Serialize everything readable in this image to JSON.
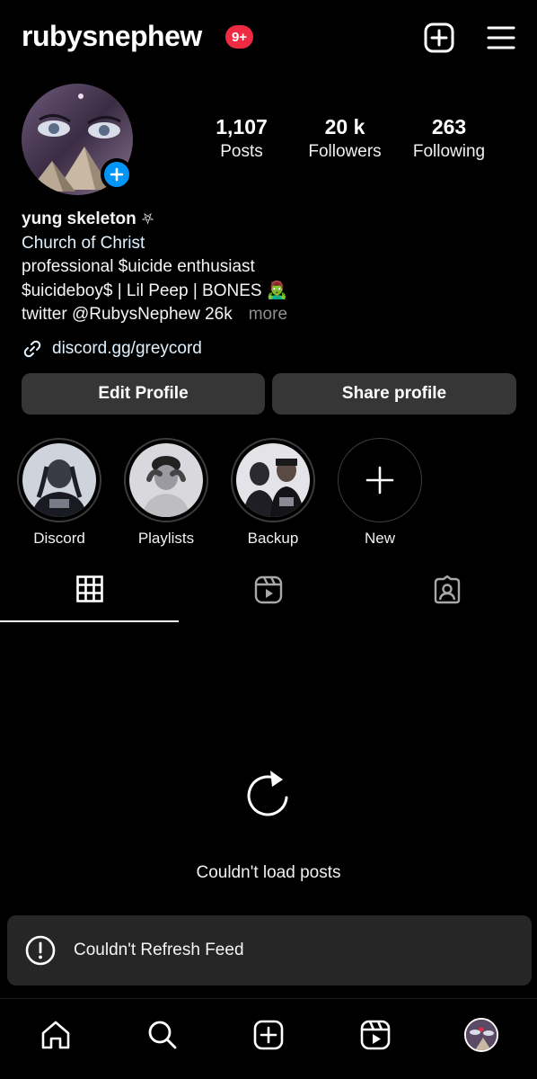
{
  "header": {
    "username": "rubysnephew",
    "notification_badge": "9+",
    "icons": [
      "add-post-icon",
      "menu-icon"
    ]
  },
  "profile": {
    "stats": {
      "posts_value": "1,107",
      "posts_label": "Posts",
      "followers_value": "20 k",
      "followers_label": "Followers",
      "following_value": "263",
      "following_label": "Following"
    },
    "display_name": "yung skeleton",
    "display_name_symbol": "⛧",
    "category": "Church of Christ",
    "bio_lines": [
      "professional $uicide enthusiast",
      "$uicideboy$ | Lil Peep | BONES 🧟‍♂️",
      "twitter @RubysNephew 26k"
    ],
    "more_label": "more",
    "link": "discord.gg/greycord"
  },
  "buttons": {
    "edit_profile": "Edit Profile",
    "share_profile": "Share profile"
  },
  "highlights": [
    {
      "label": "Discord"
    },
    {
      "label": "Playlists"
    },
    {
      "label": "Backup"
    },
    {
      "label": "New"
    }
  ],
  "tabs": [
    "grid-icon",
    "reels-icon",
    "tagged-icon"
  ],
  "feed": {
    "error_message": "Couldn't load posts"
  },
  "toast": {
    "message": "Couldn't Refresh Feed"
  },
  "bottom_nav": [
    "home-icon",
    "search-icon",
    "create-icon",
    "reels-icon",
    "profile-avatar"
  ],
  "colors": {
    "background": "#000000",
    "button": "#363636",
    "accent_blue": "#0095f6",
    "badge_red": "#ef2b43",
    "toast_bg": "#262626",
    "muted": "#8e8e8e"
  }
}
